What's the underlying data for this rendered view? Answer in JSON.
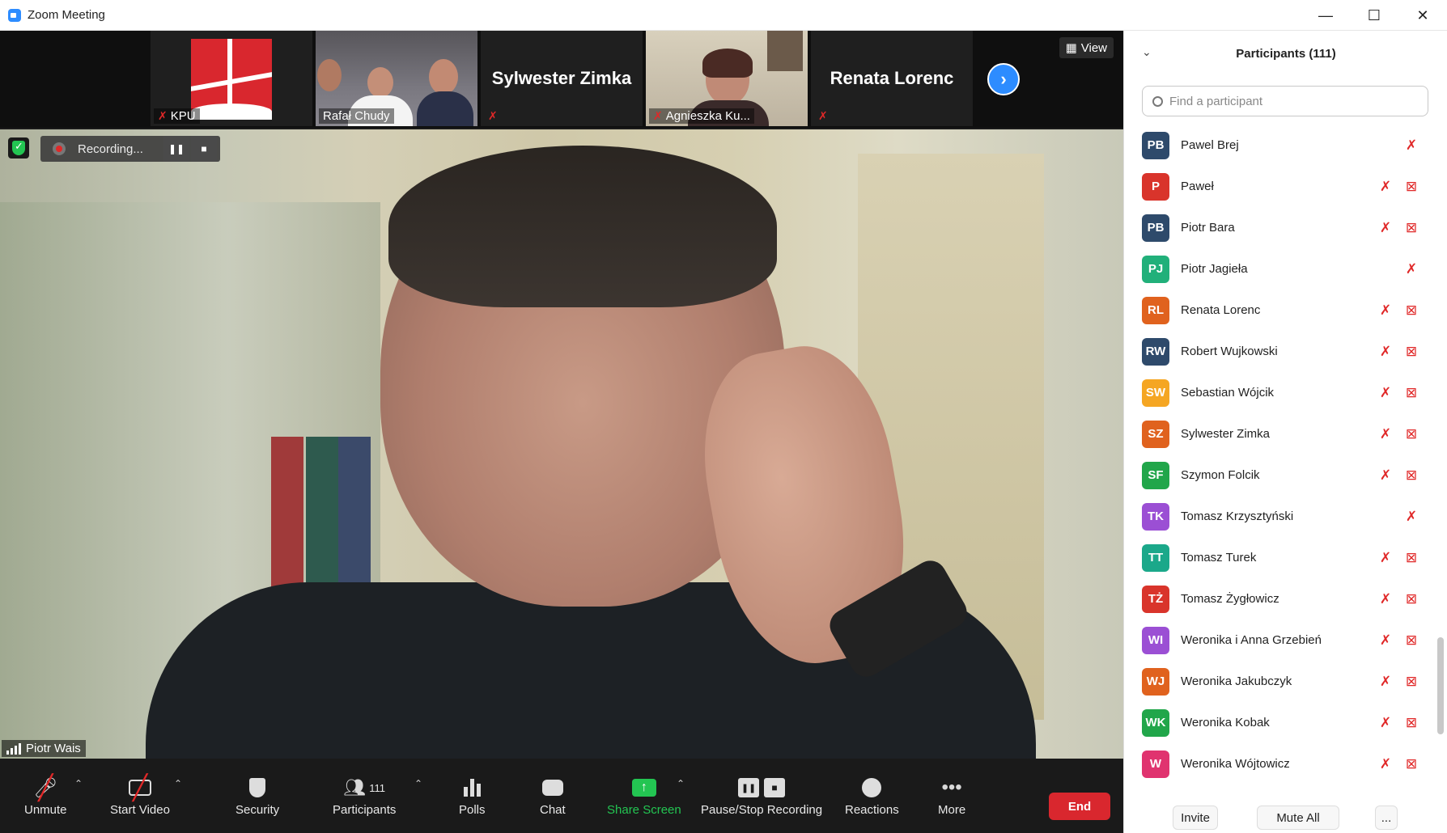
{
  "window": {
    "title": "Zoom Meeting",
    "controls": [
      "—",
      "☐",
      "✕"
    ]
  },
  "strip": {
    "thumbs": [
      {
        "name": "KPU",
        "kind": "logo"
      },
      {
        "name": "Rafał Chudy",
        "kind": "video"
      },
      {
        "name": "Sylwester Zimka",
        "kind": "name"
      },
      {
        "name": "Agnieszka Ku...",
        "kind": "video"
      },
      {
        "name": "Renata Lorenc",
        "kind": "name"
      }
    ],
    "view_label": "View"
  },
  "main": {
    "recording_label": "Recording...",
    "speaker_name": "Piotr Wais"
  },
  "toolbar": {
    "unmute": "Unmute",
    "start_video": "Start Video",
    "security": "Security",
    "participants": "Participants",
    "participants_count": "111",
    "polls": "Polls",
    "chat": "Chat",
    "share_screen": "Share Screen",
    "pause_stop_recording": "Pause/Stop Recording",
    "reactions": "Reactions",
    "more": "More",
    "end": "End"
  },
  "panel": {
    "title": "Participants (111)",
    "search_placeholder": "Find a participant",
    "participants": [
      {
        "initials": "PB",
        "name": "Pawel Brej",
        "color": "#2e4a6b",
        "video_off": false
      },
      {
        "initials": "P",
        "name": "Paweł",
        "color": "#d9342b",
        "video_off": true
      },
      {
        "initials": "PB",
        "name": "Piotr Bara",
        "color": "#2e4a6b",
        "video_off": true
      },
      {
        "initials": "PJ",
        "name": "Piotr Jagieła",
        "color": "#21b07a",
        "video_off": false
      },
      {
        "initials": "RL",
        "name": "Renata Lorenc",
        "color": "#e0621e",
        "video_off": true
      },
      {
        "initials": "RW",
        "name": "Robert Wujkowski",
        "color": "#2e4a6b",
        "video_off": true
      },
      {
        "initials": "SW",
        "name": "Sebastian Wójcik",
        "color": "#f5a623",
        "video_off": true
      },
      {
        "initials": "SZ",
        "name": "Sylwester Zimka",
        "color": "#e0621e",
        "video_off": true
      },
      {
        "initials": "SF",
        "name": "Szymon Folcik",
        "color": "#21a64a",
        "video_off": true
      },
      {
        "initials": "TK",
        "name": "Tomasz Krzysztyński",
        "color": "#9b4fd4",
        "video_off": false
      },
      {
        "initials": "TT",
        "name": "Tomasz Turek",
        "color": "#1ba88a",
        "video_off": true
      },
      {
        "initials": "TŻ",
        "name": "Tomasz Żygłowicz",
        "color": "#d9342b",
        "video_off": true
      },
      {
        "initials": "WI",
        "name": "Weronika i Anna Grzebień",
        "color": "#9b4fd4",
        "video_off": true
      },
      {
        "initials": "WJ",
        "name": "Weronika Jakubczyk",
        "color": "#e0621e",
        "video_off": true
      },
      {
        "initials": "WK",
        "name": "Weronika Kobak",
        "color": "#21a64a",
        "video_off": true
      },
      {
        "initials": "W",
        "name": "Weronika Wójtowicz",
        "color": "#e0336f",
        "video_off": true
      }
    ],
    "invite": "Invite",
    "mute_all": "Mute All",
    "more": "..."
  }
}
